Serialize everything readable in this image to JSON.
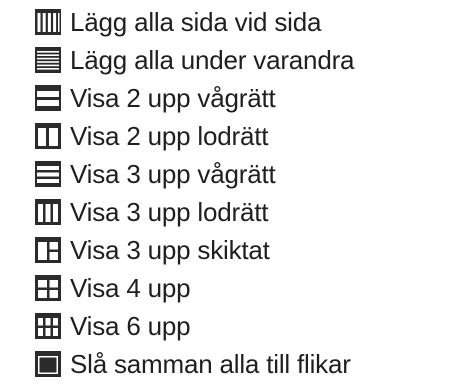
{
  "menu": {
    "items": [
      {
        "label": "Lägg alla sida vid sida",
        "icon": "tile-vertical-columns-icon"
      },
      {
        "label": "Lägg alla under varandra",
        "icon": "stack-horizontal-rows-icon"
      },
      {
        "label": "Visa 2 upp vågrätt",
        "icon": "two-up-horizontal-icon"
      },
      {
        "label": "Visa 2 upp lodrätt",
        "icon": "two-up-vertical-icon"
      },
      {
        "label": "Visa 3 upp vågrätt",
        "icon": "three-up-horizontal-icon"
      },
      {
        "label": "Visa 3 upp lodrätt",
        "icon": "three-up-vertical-icon"
      },
      {
        "label": "Visa 3 upp skiktat",
        "icon": "three-up-stacked-icon"
      },
      {
        "label": "Visa 4 upp",
        "icon": "four-up-grid-icon"
      },
      {
        "label": "Visa 6 upp",
        "icon": "six-up-grid-icon"
      },
      {
        "label": "Slå samman alla till flikar",
        "icon": "merge-into-tabs-icon"
      }
    ]
  },
  "colors": {
    "icon": "#2b2b2b",
    "text": "#1f1f1f",
    "background": "#ffffff"
  }
}
